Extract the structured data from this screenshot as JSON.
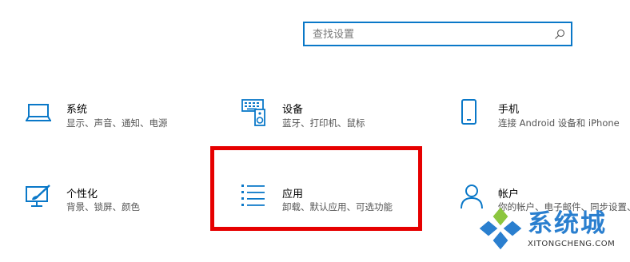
{
  "search": {
    "placeholder": "查找设置"
  },
  "items": {
    "system": {
      "title": "系统",
      "desc": "显示、声音、通知、电源"
    },
    "devices": {
      "title": "设备",
      "desc": "蓝牙、打印机、鼠标"
    },
    "phone": {
      "title": "手机",
      "desc": "连接 Android 设备和 iPhone"
    },
    "personalization": {
      "title": "个性化",
      "desc": "背景、锁屏、颜色"
    },
    "apps": {
      "title": "应用",
      "desc": "卸载、默认应用、可选功能"
    },
    "accounts": {
      "title": "帐户",
      "desc": "你的帐户、电子邮件、同步设置、工作、家庭"
    }
  },
  "watermark": {
    "text": "系统城",
    "url": "XITONGCHENG.COM"
  },
  "colors": {
    "accent": "#0a78c8",
    "highlight": "#e60000"
  }
}
